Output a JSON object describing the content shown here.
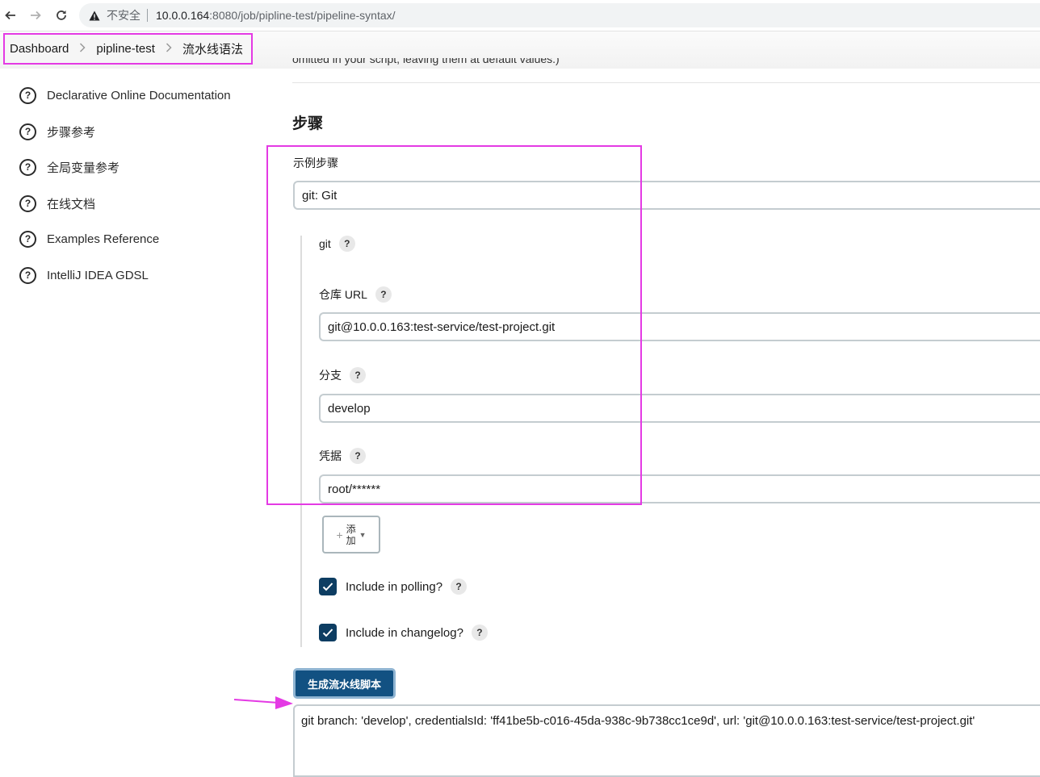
{
  "browser": {
    "insecure_label": "不安全",
    "url_host": "10.0.0.164",
    "url_rest": ":8080/job/pipline-test/pipeline-syntax/"
  },
  "breadcrumb": {
    "items": [
      "Dashboard",
      "pipline-test",
      "流水线语法"
    ],
    "separator": ">"
  },
  "sidebar": {
    "items": [
      {
        "label": "Declarative Online Documentation",
        "icon": "help-circle-icon"
      },
      {
        "label": "步骤参考",
        "icon": "help-circle-icon"
      },
      {
        "label": "全局变量参考",
        "icon": "help-circle-icon"
      },
      {
        "label": "在线文档",
        "icon": "help-circle-icon"
      },
      {
        "label": "Examples Reference",
        "icon": "help-circle-icon"
      },
      {
        "label": "IntelliJ IDEA GDSL",
        "icon": "help-circle-icon"
      }
    ]
  },
  "main": {
    "cut_off_text": "omitted in your script, leaving them at default values.)",
    "section_title": "步骤",
    "sample_step_label": "示例步骤",
    "sample_step_value": "git: Git",
    "git_label": "git",
    "repo_url_label": "仓库 URL",
    "repo_url_value": "git@10.0.0.163:test-service/test-project.git",
    "branch_label": "分支",
    "branch_value": "develop",
    "credentials_label": "凭据",
    "credentials_value": "root/******",
    "add_button_label": "添加",
    "include_polling_label": "Include in polling?",
    "include_polling_checked": true,
    "include_changelog_label": "Include in changelog?",
    "include_changelog_checked": true,
    "help_symbol": "?",
    "generate_button_label": "生成流水线脚本",
    "generated_script": "git branch: 'develop', credentialsId: 'ff41be5b-c016-45da-938c-9b738cc1ce9d', url: 'git@10.0.0.163:test-service/test-project.git'"
  },
  "colors": {
    "highlight": "#e43ae4",
    "primary_button": "#125182",
    "checkbox": "#0d3d62"
  }
}
